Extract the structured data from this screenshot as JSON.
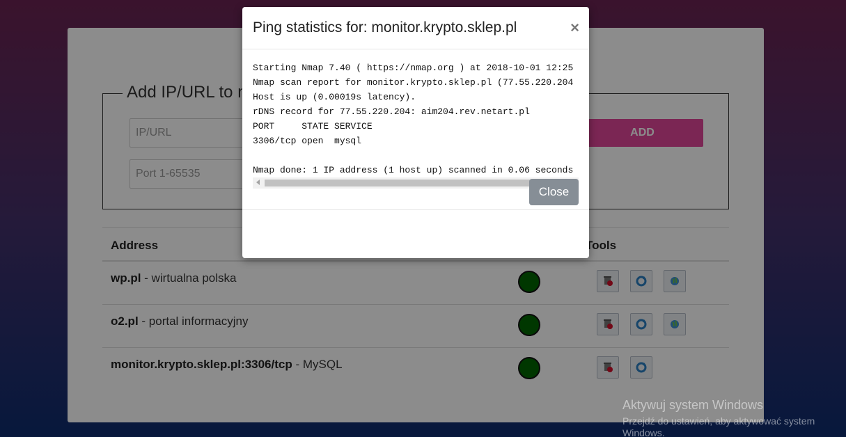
{
  "form": {
    "legend": "Add IP/URL to m",
    "ip_placeholder": "IP/URL",
    "port_placeholder": "Port 1-65535",
    "add_label": "ADD"
  },
  "table": {
    "headers": {
      "address": "Address",
      "tools": "Tools"
    },
    "rows": [
      {
        "host": "wp.pl",
        "desc": " - wirtualna polska",
        "status_color": "#006400"
      },
      {
        "host": "o2.pl",
        "desc": " - portal informacyjny",
        "status_color": "#006400"
      },
      {
        "host": "monitor.krypto.sklep.pl:3306/tcp",
        "desc": " - MySQL",
        "status_color": "#006400"
      }
    ]
  },
  "modal": {
    "title": "Ping statistics for: monitor.krypto.sklep.pl",
    "close_x": "×",
    "output": [
      "Starting Nmap 7.40 ( https://nmap.org ) at 2018-10-01 12:25",
      "Nmap scan report for monitor.krypto.sklep.pl (77.55.220.204",
      "Host is up (0.00019s latency).",
      "rDNS record for 77.55.220.204: aim204.rev.netart.pl",
      "PORT     STATE SERVICE",
      "3306/tcp open  mysql",
      "",
      "Nmap done: 1 IP address (1 host up) scanned in 0.06 seconds"
    ],
    "close_label": "Close"
  },
  "icons": {
    "tool_1": "delete-icon",
    "tool_2": "refresh-icon",
    "tool_3": "globe-icon"
  },
  "watermark": {
    "line1": "Aktywuj system Windows",
    "line2": "Przejdź do ustawień, aby aktywować system Windows."
  }
}
